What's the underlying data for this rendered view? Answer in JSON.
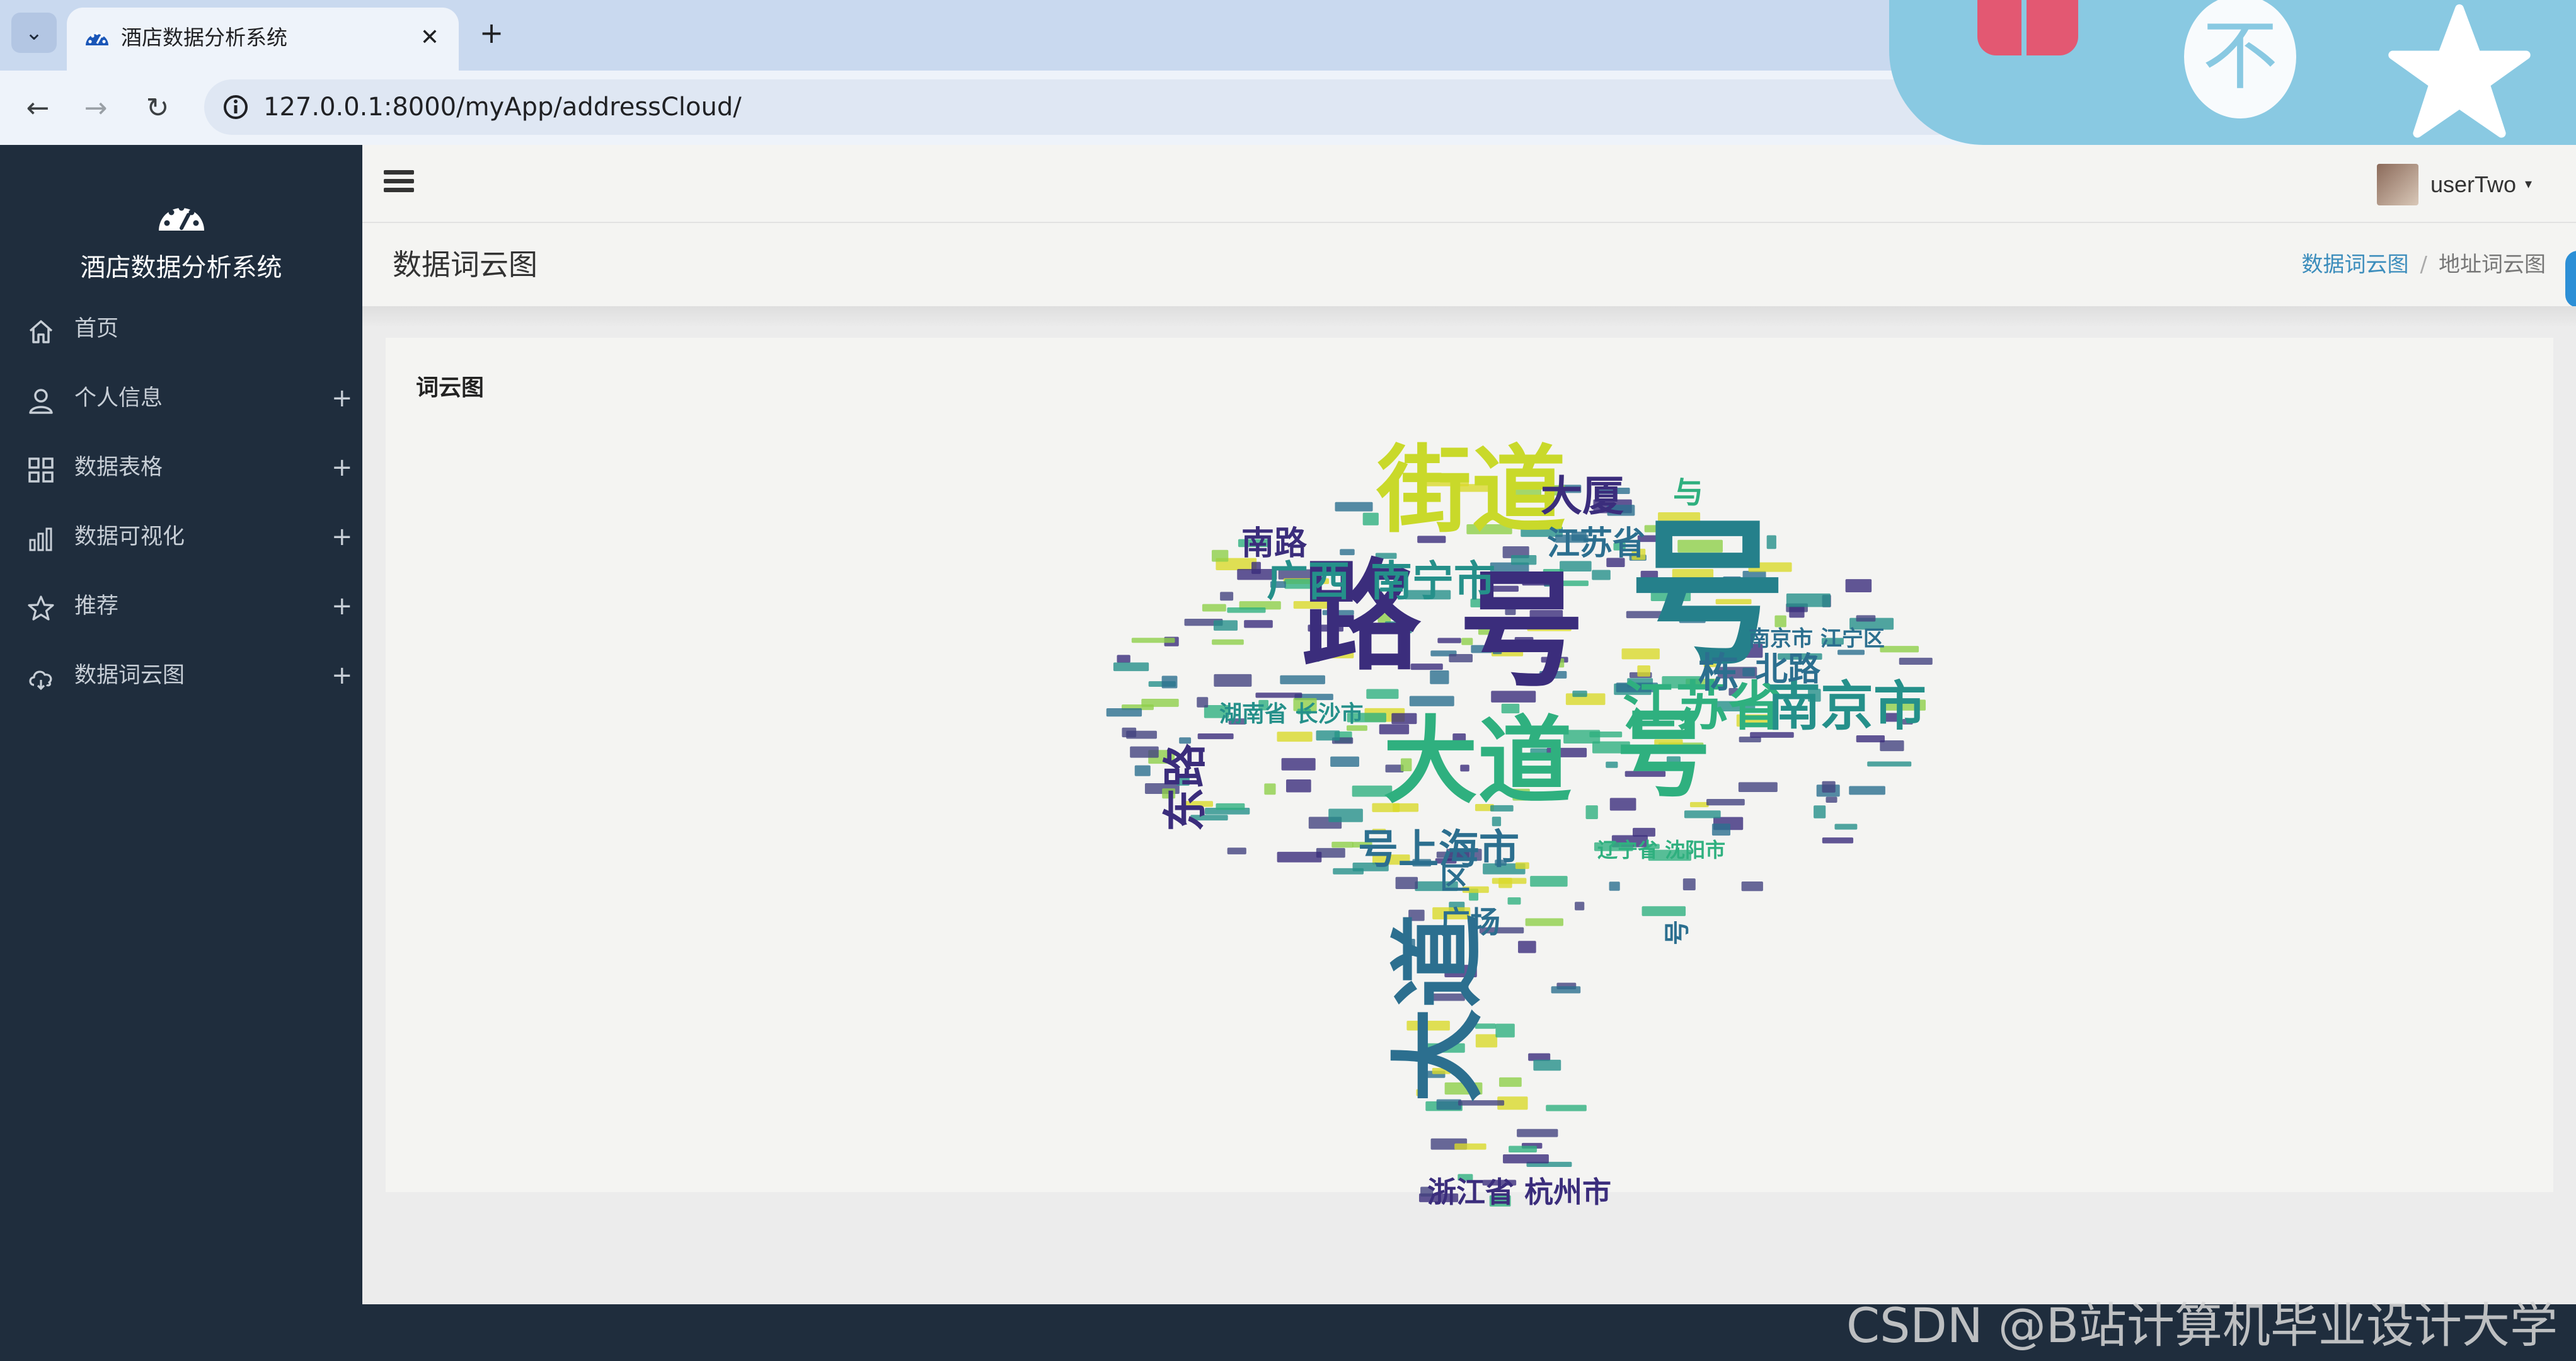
{
  "browser": {
    "tab_title": "酒店数据分析系统",
    "tab_list_icon": "chevron-down-icon",
    "close_glyph": "✕",
    "new_tab_glyph": "+",
    "url": "127.0.0.1:8000/myApp/addressCloud/"
  },
  "overlay": {
    "circle_glyph": "不"
  },
  "sidebar": {
    "brand_name": "酒店数据分析系统",
    "brand_icon": "dashboard-gauge-icon",
    "items": [
      {
        "label": "首页",
        "icon": "home-icon",
        "has_submenu": false
      },
      {
        "label": "个人信息",
        "icon": "user-icon",
        "has_submenu": true
      },
      {
        "label": "数据表格",
        "icon": "grid-icon",
        "has_submenu": true
      },
      {
        "label": "数据可视化",
        "icon": "bar-chart-icon",
        "has_submenu": true
      },
      {
        "label": "推荐",
        "icon": "star-icon",
        "has_submenu": true
      },
      {
        "label": "数据词云图",
        "icon": "cloud-icon",
        "has_submenu": true
      }
    ],
    "plus_glyph": "+"
  },
  "header": {
    "username": "userTwo",
    "caret": "▾"
  },
  "page": {
    "title": "数据词云图",
    "breadcrumb": [
      "数据词云图",
      "地址词云图"
    ],
    "breadcrumb_sep": "/"
  },
  "card": {
    "title": "词云图"
  },
  "wordcloud": {
    "colors": [
      "#3b2d7c",
      "#2c6f8f",
      "#25908a",
      "#2fb07f",
      "#8fcf4a",
      "#d9d92a",
      "#43447f"
    ],
    "words": [
      {
        "text": "号",
        "color": "#25808b"
      },
      {
        "text": "路",
        "color": "#3b2d7c"
      },
      {
        "text": "号",
        "color": "#3b2d7c"
      },
      {
        "text": "大道",
        "color": "#2fb07f"
      },
      {
        "text": "号",
        "color": "#2fb07f"
      },
      {
        "text": "街道",
        "color": "#c9d92a"
      },
      {
        "text": "大道",
        "color": "#2c6f8f"
      },
      {
        "text": "江苏省",
        "color": "#2fb07f"
      },
      {
        "text": "南京市",
        "color": "#25908a"
      },
      {
        "text": "广西",
        "color": "#25908a"
      },
      {
        "text": "南宁市",
        "color": "#25908a"
      },
      {
        "text": "号上海市",
        "color": "#2c6f8f"
      },
      {
        "text": "大厦",
        "color": "#3b2d7c"
      },
      {
        "text": "江苏省",
        "color": "#2c6f8f"
      },
      {
        "text": "南路",
        "color": "#3b2d7c"
      },
      {
        "text": "东路",
        "color": "#3b2d7c"
      },
      {
        "text": "栋",
        "color": "#2c6f8f"
      },
      {
        "text": "北路",
        "color": "#2c6f8f"
      },
      {
        "text": "广场",
        "color": "#2c6f8f"
      },
      {
        "text": "区",
        "color": "#2c6f8f"
      },
      {
        "text": "湖南省 长沙市",
        "color": "#25908a"
      },
      {
        "text": "浙江省 杭州市",
        "color": "#3b2d7c"
      },
      {
        "text": "辽宁省 沈阳市",
        "color": "#2fb07f"
      },
      {
        "text": "南京市 江宁区",
        "color": "#2c6f8f"
      },
      {
        "text": "与",
        "color": "#2fb07f"
      },
      {
        "text": "号",
        "color": "#2c6f8f"
      }
    ]
  }
}
